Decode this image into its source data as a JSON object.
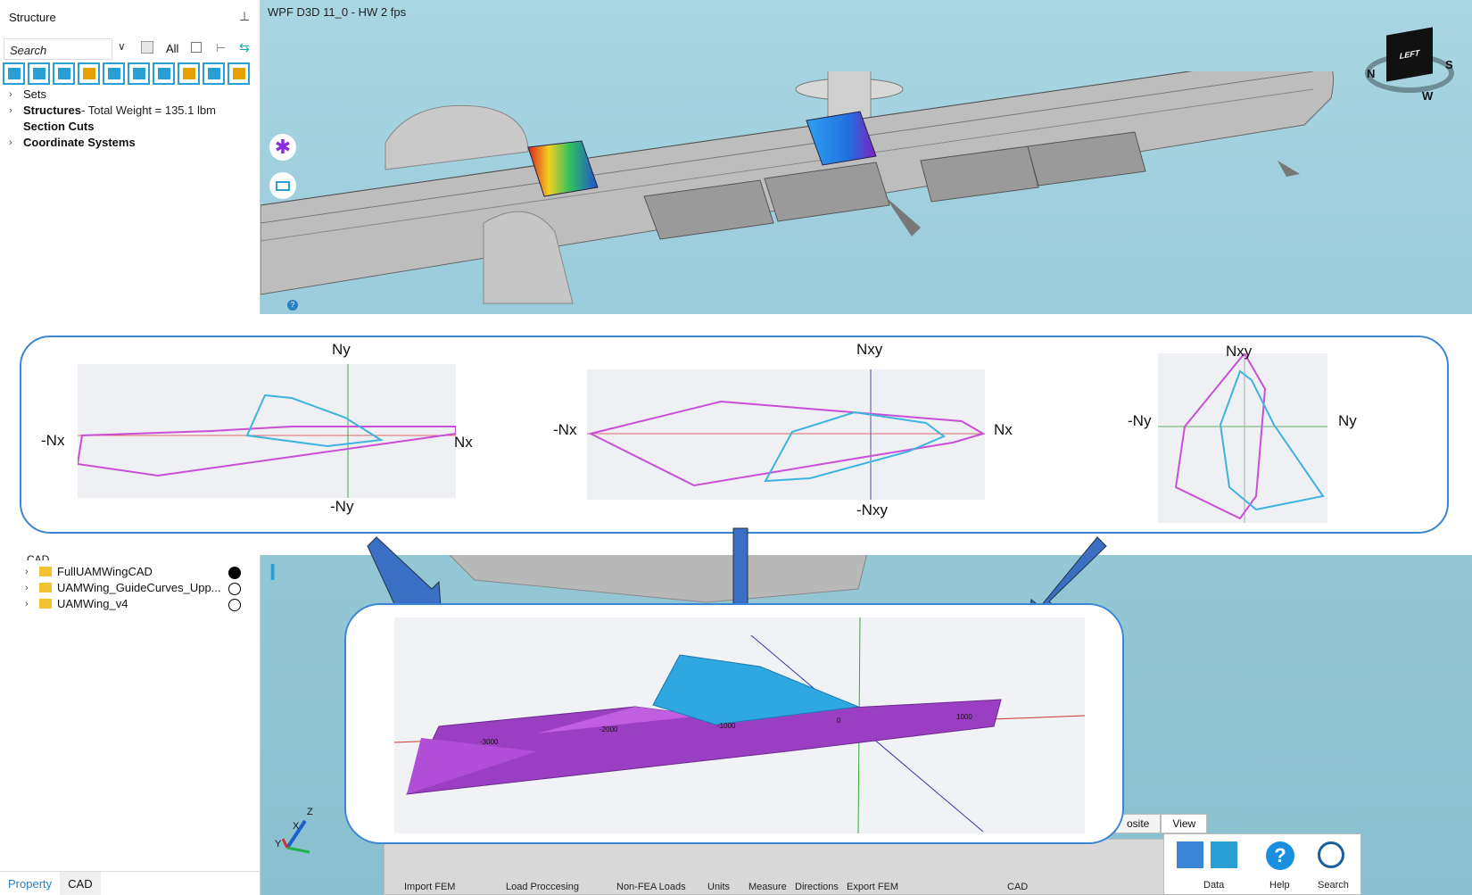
{
  "panel": {
    "title": "Structure",
    "search_placeholder": "Search",
    "all_label": "All",
    "tree": [
      {
        "label": "Sets",
        "suffix": ""
      },
      {
        "label": "Structures",
        "suffix": " - Total Weight = 135.1 lbm"
      },
      {
        "label": "Section Cuts",
        "suffix": ""
      },
      {
        "label": "Coordinate Systems",
        "suffix": ""
      }
    ],
    "cad_group": "CAD",
    "cad_items": [
      {
        "label": "FullUAMWingCAD",
        "state": "filled"
      },
      {
        "label": "UAMWing_GuideCurves_Upp...",
        "state": "empty"
      },
      {
        "label": "UAMWing_v4",
        "state": "empty"
      }
    ],
    "tabs": [
      "Property",
      "CAD"
    ]
  },
  "viewport": {
    "title": "WPF D3D 11_0 - HW 2 fps",
    "cube_label": "LEFT",
    "compass": [
      "N",
      "W",
      "S"
    ],
    "axes": [
      "Z",
      "X",
      "Y"
    ]
  },
  "plots": [
    {
      "top": "Ny",
      "bottom": "-Ny",
      "left": "-Nx",
      "right": "Nx"
    },
    {
      "top": "Nxy",
      "bottom": "-Nxy",
      "left": "-Nx",
      "right": "Nx"
    },
    {
      "top": "Nxy",
      "left": "-Ny",
      "right": "Ny"
    }
  ],
  "lower_ticks": [
    "-3000",
    "-2000",
    "-1000",
    "0",
    "1000"
  ],
  "ribbon": {
    "groups": [
      "Import FEM",
      "Load Proccesing",
      "Non-FEA Loads",
      "Units",
      "Measure",
      "Directions",
      "Export FEM",
      "CAD"
    ],
    "tabs": [
      "osite",
      "View"
    ],
    "right": [
      "Data",
      "Help",
      "Search"
    ]
  },
  "colors": {
    "accent": "#2a9fd6",
    "envelope_magenta": "#c94fd6",
    "envelope_cyan": "#3fb3e0",
    "frame": "#3a86d4"
  }
}
